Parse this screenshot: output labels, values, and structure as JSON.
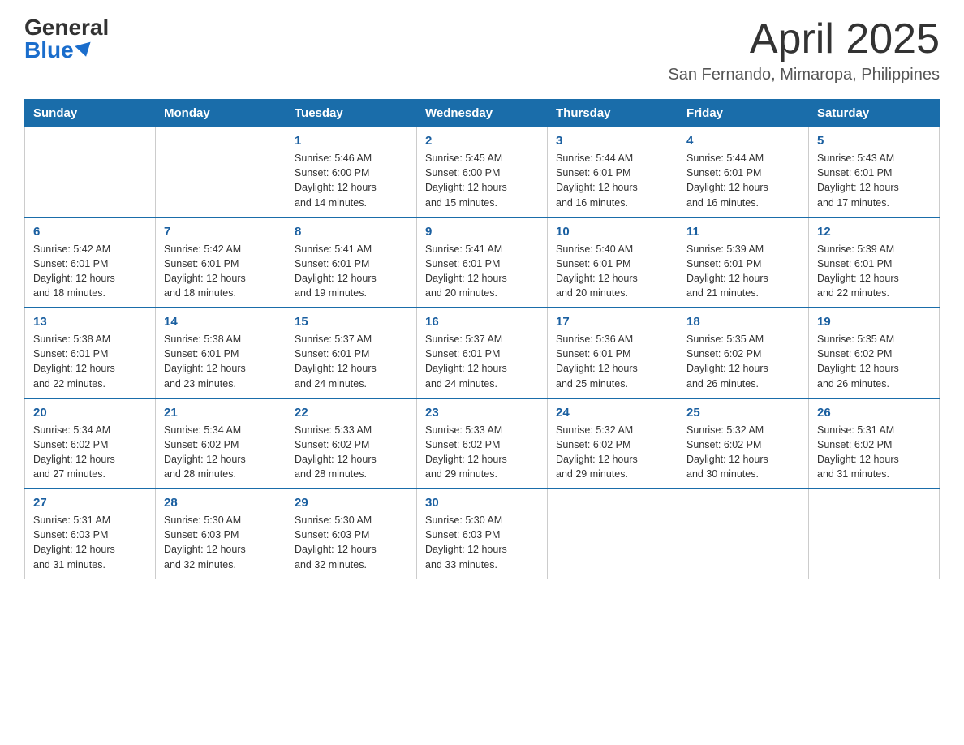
{
  "header": {
    "logo_general": "General",
    "logo_blue": "Blue",
    "month_title": "April 2025",
    "location": "San Fernando, Mimaropa, Philippines"
  },
  "weekdays": [
    "Sunday",
    "Monday",
    "Tuesday",
    "Wednesday",
    "Thursday",
    "Friday",
    "Saturday"
  ],
  "weeks": [
    [
      {
        "day": "",
        "info": ""
      },
      {
        "day": "",
        "info": ""
      },
      {
        "day": "1",
        "info": "Sunrise: 5:46 AM\nSunset: 6:00 PM\nDaylight: 12 hours\nand 14 minutes."
      },
      {
        "day": "2",
        "info": "Sunrise: 5:45 AM\nSunset: 6:00 PM\nDaylight: 12 hours\nand 15 minutes."
      },
      {
        "day": "3",
        "info": "Sunrise: 5:44 AM\nSunset: 6:01 PM\nDaylight: 12 hours\nand 16 minutes."
      },
      {
        "day": "4",
        "info": "Sunrise: 5:44 AM\nSunset: 6:01 PM\nDaylight: 12 hours\nand 16 minutes."
      },
      {
        "day": "5",
        "info": "Sunrise: 5:43 AM\nSunset: 6:01 PM\nDaylight: 12 hours\nand 17 minutes."
      }
    ],
    [
      {
        "day": "6",
        "info": "Sunrise: 5:42 AM\nSunset: 6:01 PM\nDaylight: 12 hours\nand 18 minutes."
      },
      {
        "day": "7",
        "info": "Sunrise: 5:42 AM\nSunset: 6:01 PM\nDaylight: 12 hours\nand 18 minutes."
      },
      {
        "day": "8",
        "info": "Sunrise: 5:41 AM\nSunset: 6:01 PM\nDaylight: 12 hours\nand 19 minutes."
      },
      {
        "day": "9",
        "info": "Sunrise: 5:41 AM\nSunset: 6:01 PM\nDaylight: 12 hours\nand 20 minutes."
      },
      {
        "day": "10",
        "info": "Sunrise: 5:40 AM\nSunset: 6:01 PM\nDaylight: 12 hours\nand 20 minutes."
      },
      {
        "day": "11",
        "info": "Sunrise: 5:39 AM\nSunset: 6:01 PM\nDaylight: 12 hours\nand 21 minutes."
      },
      {
        "day": "12",
        "info": "Sunrise: 5:39 AM\nSunset: 6:01 PM\nDaylight: 12 hours\nand 22 minutes."
      }
    ],
    [
      {
        "day": "13",
        "info": "Sunrise: 5:38 AM\nSunset: 6:01 PM\nDaylight: 12 hours\nand 22 minutes."
      },
      {
        "day": "14",
        "info": "Sunrise: 5:38 AM\nSunset: 6:01 PM\nDaylight: 12 hours\nand 23 minutes."
      },
      {
        "day": "15",
        "info": "Sunrise: 5:37 AM\nSunset: 6:01 PM\nDaylight: 12 hours\nand 24 minutes."
      },
      {
        "day": "16",
        "info": "Sunrise: 5:37 AM\nSunset: 6:01 PM\nDaylight: 12 hours\nand 24 minutes."
      },
      {
        "day": "17",
        "info": "Sunrise: 5:36 AM\nSunset: 6:01 PM\nDaylight: 12 hours\nand 25 minutes."
      },
      {
        "day": "18",
        "info": "Sunrise: 5:35 AM\nSunset: 6:02 PM\nDaylight: 12 hours\nand 26 minutes."
      },
      {
        "day": "19",
        "info": "Sunrise: 5:35 AM\nSunset: 6:02 PM\nDaylight: 12 hours\nand 26 minutes."
      }
    ],
    [
      {
        "day": "20",
        "info": "Sunrise: 5:34 AM\nSunset: 6:02 PM\nDaylight: 12 hours\nand 27 minutes."
      },
      {
        "day": "21",
        "info": "Sunrise: 5:34 AM\nSunset: 6:02 PM\nDaylight: 12 hours\nand 28 minutes."
      },
      {
        "day": "22",
        "info": "Sunrise: 5:33 AM\nSunset: 6:02 PM\nDaylight: 12 hours\nand 28 minutes."
      },
      {
        "day": "23",
        "info": "Sunrise: 5:33 AM\nSunset: 6:02 PM\nDaylight: 12 hours\nand 29 minutes."
      },
      {
        "day": "24",
        "info": "Sunrise: 5:32 AM\nSunset: 6:02 PM\nDaylight: 12 hours\nand 29 minutes."
      },
      {
        "day": "25",
        "info": "Sunrise: 5:32 AM\nSunset: 6:02 PM\nDaylight: 12 hours\nand 30 minutes."
      },
      {
        "day": "26",
        "info": "Sunrise: 5:31 AM\nSunset: 6:02 PM\nDaylight: 12 hours\nand 31 minutes."
      }
    ],
    [
      {
        "day": "27",
        "info": "Sunrise: 5:31 AM\nSunset: 6:03 PM\nDaylight: 12 hours\nand 31 minutes."
      },
      {
        "day": "28",
        "info": "Sunrise: 5:30 AM\nSunset: 6:03 PM\nDaylight: 12 hours\nand 32 minutes."
      },
      {
        "day": "29",
        "info": "Sunrise: 5:30 AM\nSunset: 6:03 PM\nDaylight: 12 hours\nand 32 minutes."
      },
      {
        "day": "30",
        "info": "Sunrise: 5:30 AM\nSunset: 6:03 PM\nDaylight: 12 hours\nand 33 minutes."
      },
      {
        "day": "",
        "info": ""
      },
      {
        "day": "",
        "info": ""
      },
      {
        "day": "",
        "info": ""
      }
    ]
  ]
}
